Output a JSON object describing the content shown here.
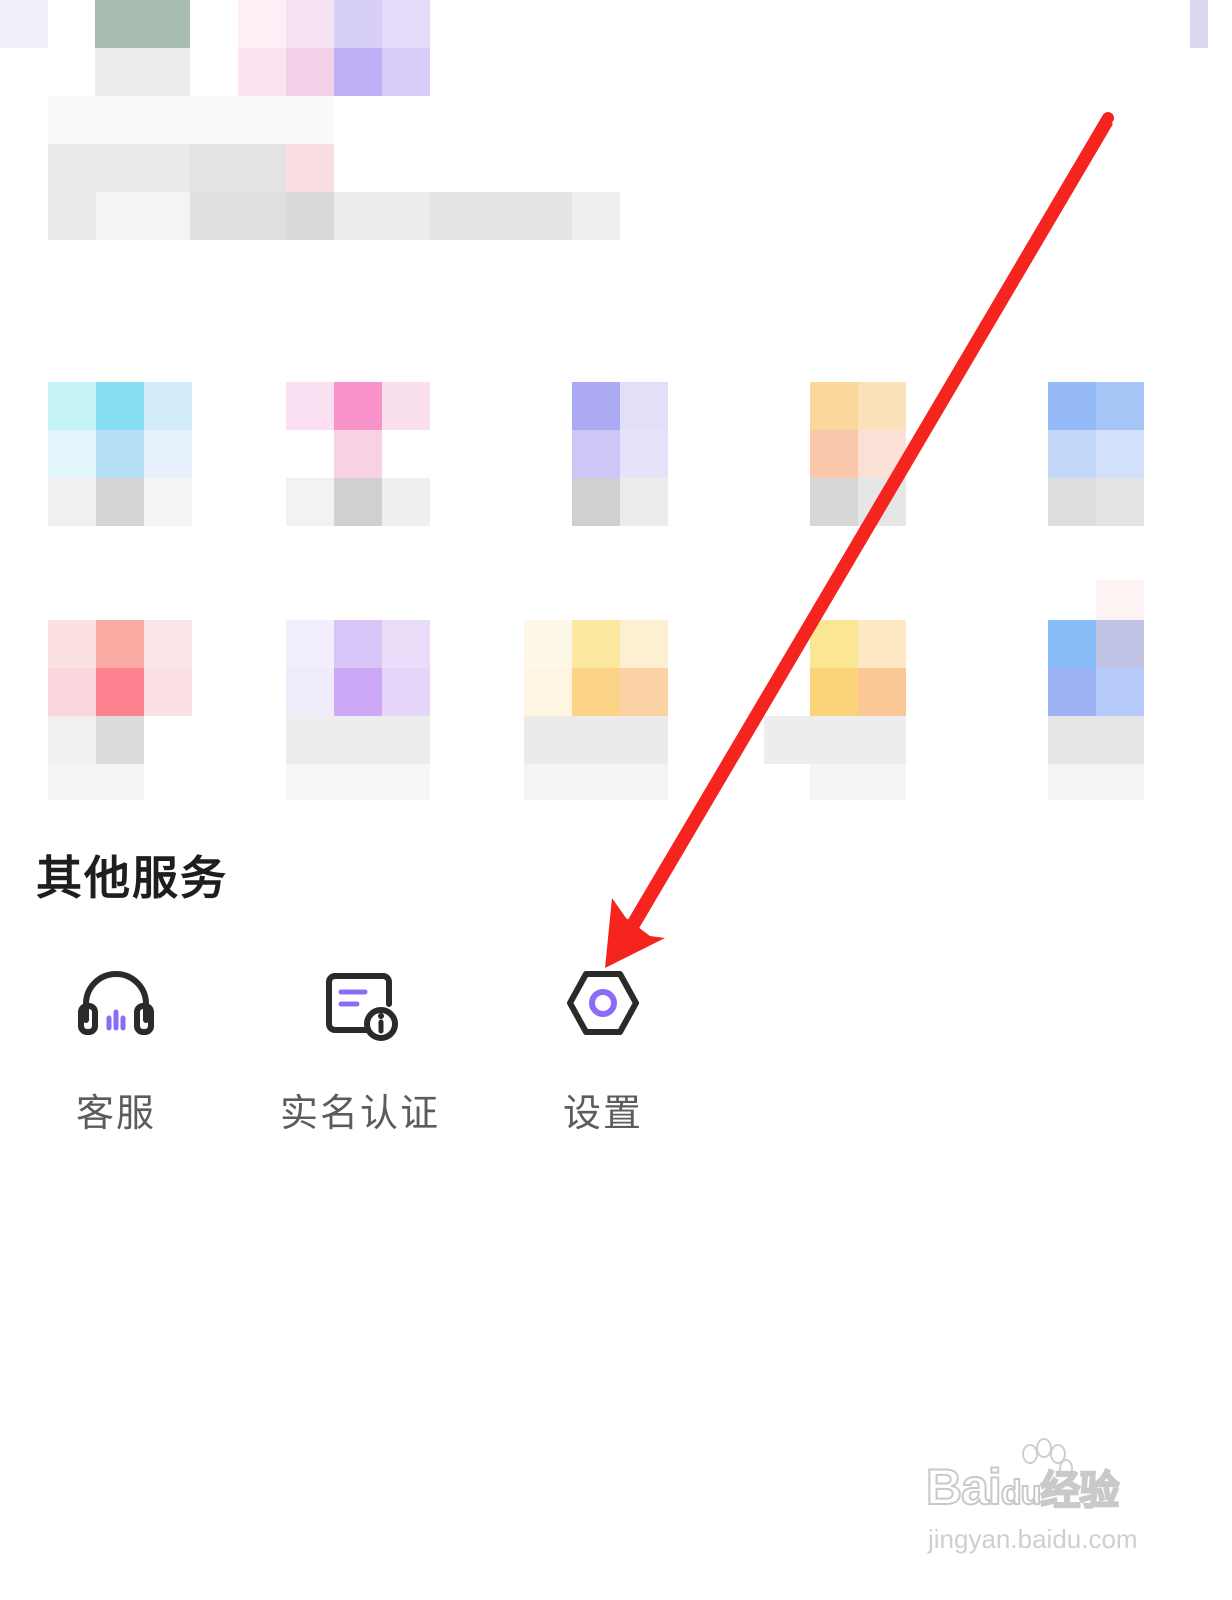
{
  "section": {
    "title": "其他服务"
  },
  "services": [
    {
      "label": "客服",
      "icon": "headset-icon"
    },
    {
      "label": "实名认证",
      "icon": "id-card-info-icon"
    },
    {
      "label": "设置",
      "icon": "hexagon-settings-icon"
    }
  ],
  "annotation": {
    "arrow": "red-arrow-pointing-to-settings",
    "color": "#f5241f"
  },
  "watermark": {
    "brand": "Bai",
    "brand_suffix": "经验",
    "brand_paw": "du",
    "url": "jingyan.baidu.com"
  },
  "colors": {
    "accent": "#8b6cf6",
    "icon_stroke": "#2a2a2a",
    "label": "#5c5c5c"
  }
}
